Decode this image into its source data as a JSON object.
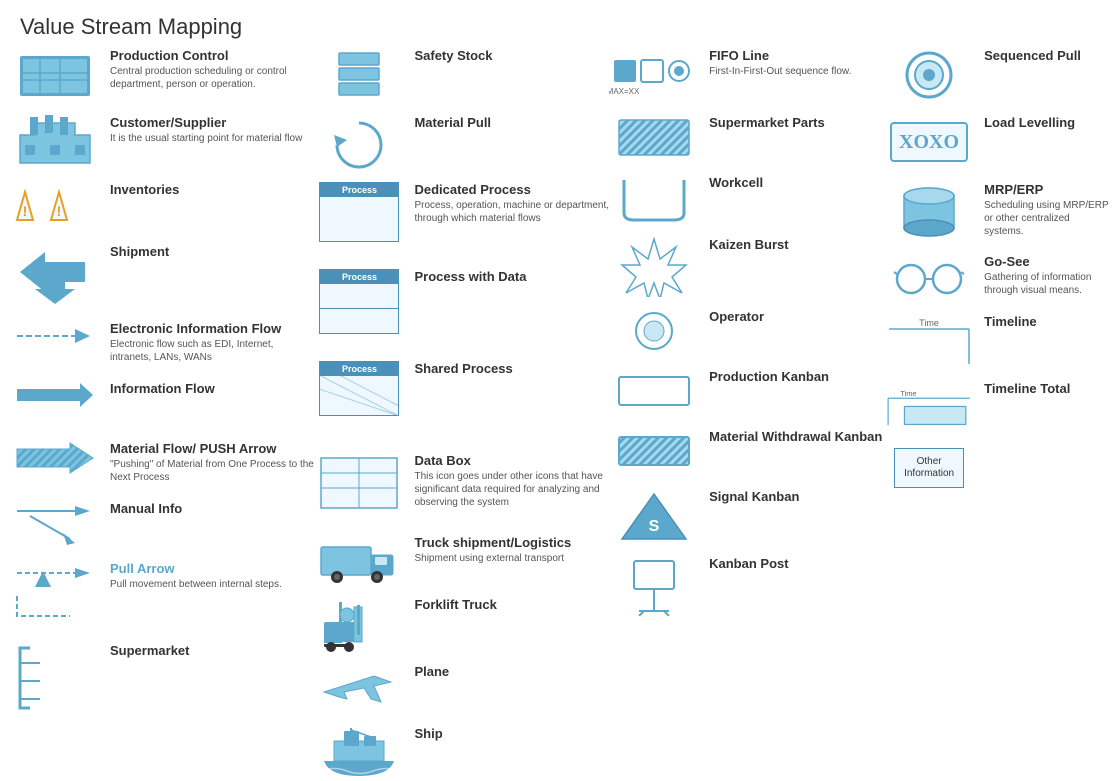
{
  "title": "Value Stream Mapping",
  "col1": {
    "items": [
      {
        "id": "production-control",
        "label": "Production Control",
        "desc": "Central production scheduling or control department, person or operation."
      },
      {
        "id": "customer-supplier",
        "label": "Customer/Supplier",
        "desc": "It is the usual starting point for material flow"
      },
      {
        "id": "inventories",
        "label": "Inventories",
        "desc": ""
      },
      {
        "id": "shipment",
        "label": "Shipment",
        "desc": ""
      },
      {
        "id": "electronic-info-flow",
        "label": "Electronic Information Flow",
        "desc": "Electronic flow such as EDI, Internet, intranets, LANs, WANs"
      },
      {
        "id": "information-flow",
        "label": "Information Flow",
        "desc": ""
      },
      {
        "id": "material-flow-push",
        "label": "Material Flow/ PUSH Arrow",
        "desc": "\"Pushing\" of Material from One Process to the Next Process"
      },
      {
        "id": "manual-info",
        "label": "Manual Info",
        "desc": ""
      },
      {
        "id": "pull-arrow",
        "label": "Pull Arrow",
        "desc": "Pull movement between internal steps."
      },
      {
        "id": "supermarket",
        "label": "Supermarket",
        "desc": ""
      }
    ]
  },
  "col2": {
    "items": [
      {
        "id": "safety-stock",
        "label": "Safety Stock",
        "desc": ""
      },
      {
        "id": "material-pull",
        "label": "Material Pull",
        "desc": ""
      },
      {
        "id": "dedicated-process",
        "label": "Dedicated Process",
        "desc": "Process, operation, machine or department, through which material flows"
      },
      {
        "id": "process-with-data",
        "label": "Process with Data",
        "desc": ""
      },
      {
        "id": "shared-process",
        "label": "Shared Process",
        "desc": ""
      },
      {
        "id": "data-box",
        "label": "Data Box",
        "desc": "This icon goes under other icons that have significant data required for analyzing and observing the system"
      },
      {
        "id": "truck-shipment",
        "label": "Truck shipment/Logistics",
        "desc": "Shipment using external transport"
      },
      {
        "id": "forklift-truck",
        "label": "Forklift Truck",
        "desc": ""
      },
      {
        "id": "plane",
        "label": "Plane",
        "desc": ""
      },
      {
        "id": "ship",
        "label": "Ship",
        "desc": ""
      }
    ]
  },
  "col3": {
    "items": [
      {
        "id": "fifo-line",
        "label": "FIFO Line",
        "desc": "First-In-First-Out sequence flow.",
        "sublabel": "MAX=XX"
      },
      {
        "id": "supermarket-parts",
        "label": "Supermarket Parts",
        "desc": ""
      },
      {
        "id": "workcell",
        "label": "Workcell",
        "desc": ""
      },
      {
        "id": "kaizen-burst",
        "label": "Kaizen Burst",
        "desc": ""
      },
      {
        "id": "operator",
        "label": "Operator",
        "desc": ""
      },
      {
        "id": "production-kanban",
        "label": "Production Kanban",
        "desc": ""
      },
      {
        "id": "material-withdrawal-kanban",
        "label": "Material Withdrawal Kanban",
        "desc": ""
      },
      {
        "id": "signal-kanban",
        "label": "Signal Kanban",
        "desc": ""
      },
      {
        "id": "kanban-post",
        "label": "Kanban Post",
        "desc": ""
      }
    ]
  },
  "col4": {
    "items": [
      {
        "id": "sequenced-pull",
        "label": "Sequenced Pull",
        "desc": ""
      },
      {
        "id": "load-levelling",
        "label": "Load Levelling",
        "desc": ""
      },
      {
        "id": "mrp-erp",
        "label": "MRP/ERP",
        "desc": "Scheduling using MRP/ERP or other centralized systems."
      },
      {
        "id": "go-see",
        "label": "Go-See",
        "desc": "Gathering of information through visual means."
      },
      {
        "id": "timeline",
        "label": "Timeline",
        "desc": ""
      },
      {
        "id": "timeline-total",
        "label": "Timeline Total",
        "desc": ""
      },
      {
        "id": "other-information",
        "label": "Other Information",
        "desc": ""
      }
    ]
  }
}
